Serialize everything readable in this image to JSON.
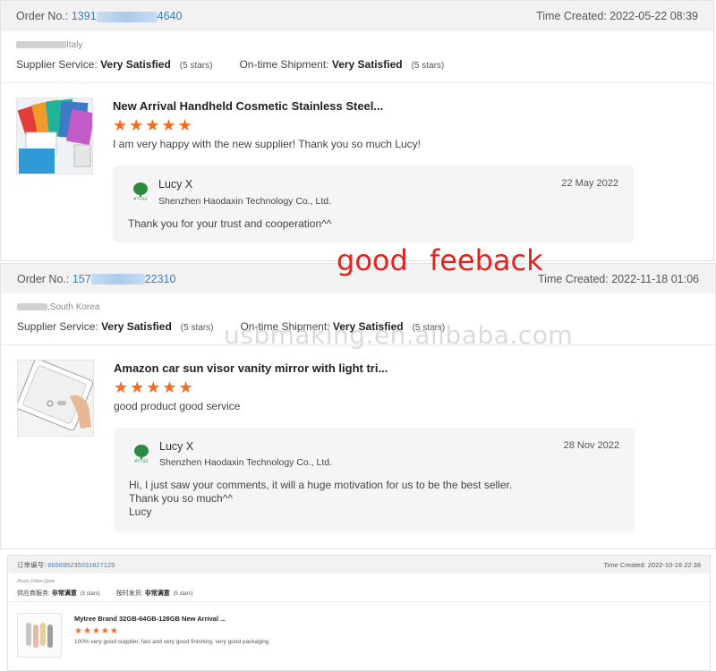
{
  "overlay": {
    "text": "good  feeback",
    "watermark": "usbmaking.en.alibaba.com"
  },
  "reviews": [
    {
      "order_label": "Order No.:",
      "order_prefix": "1391",
      "order_suffix": "4640",
      "time_label": "Time Created:",
      "time": "2022-05-22 08:39",
      "buyer_location": "Italy",
      "supplier_service_label": "Supplier Service:",
      "supplier_service_value": "Very Satisfied",
      "supplier_service_stars": "(5 stars)",
      "shipment_label": "On-time Shipment:",
      "shipment_value": "Very Satisfied",
      "shipment_stars": "(5 stars)",
      "product_title": "New Arrival Handheld Cosmetic Stainless Steel...",
      "rating": 5,
      "stars": "★★★★★",
      "comment": "I am very happy with the new supplier! Thank you so much Lucy!",
      "reply_name": "Lucy X",
      "reply_company": "Shenzhen Haodaxin Technology Co., Ltd.",
      "reply_date": "22 May 2022",
      "reply_text": "Thank you for your trust and cooperation^^"
    },
    {
      "order_label": "Order No.:",
      "order_prefix": "157",
      "order_suffix": "22310",
      "time_label": "Time Created:",
      "time": "2022-11-18 01:06",
      "buyer_location": ",South Korea",
      "supplier_service_label": "Supplier Service:",
      "supplier_service_value": "Very Satisfied",
      "supplier_service_stars": "(5 stars)",
      "shipment_label": "On-time Shipment:",
      "shipment_value": "Very Satisfied",
      "shipment_stars": "(5 stars)",
      "product_title": "Amazon car sun visor vanity mirror with light tri...",
      "rating": 5,
      "stars": "★★★★★",
      "comment": "good product good service",
      "reply_name": "Lucy X",
      "reply_company": "Shenzhen Haodaxin Technology Co., Ltd.",
      "reply_date": "28 Nov 2022",
      "reply_line1": "Hi, I just saw your comments, it will a huge motivation for us to be the best seller.",
      "reply_line2": "Thank you so much^^",
      "reply_line3": "Lucy"
    },
    {
      "order_label": "订单编号:",
      "order_no": "665695235031827125",
      "time_label": "Time Created:",
      "time": "2022-10-16 22:38",
      "buyer_location": "Jhuan Zolian,Qatar",
      "supplier_service_label": "供应商服务:",
      "supplier_service_value": "非常满意",
      "supplier_service_stars": "(5 stars)",
      "shipment_label": "按时发货:",
      "shipment_value": "非常满意",
      "shipment_stars": "(5 stars)",
      "product_title": "Mytree Brand 32GB-64GB-128GB New Arrival ...",
      "rating": 5,
      "stars": "★★★★★",
      "comment": "100% very good supplier, fast and very good finishing. very good packaging"
    }
  ],
  "brand_logo_text": "MYTREE",
  "colors": {
    "accent_blue": "#2f7fd0",
    "star_orange": "#f56b1f",
    "header_gray": "#f2f2f2"
  }
}
